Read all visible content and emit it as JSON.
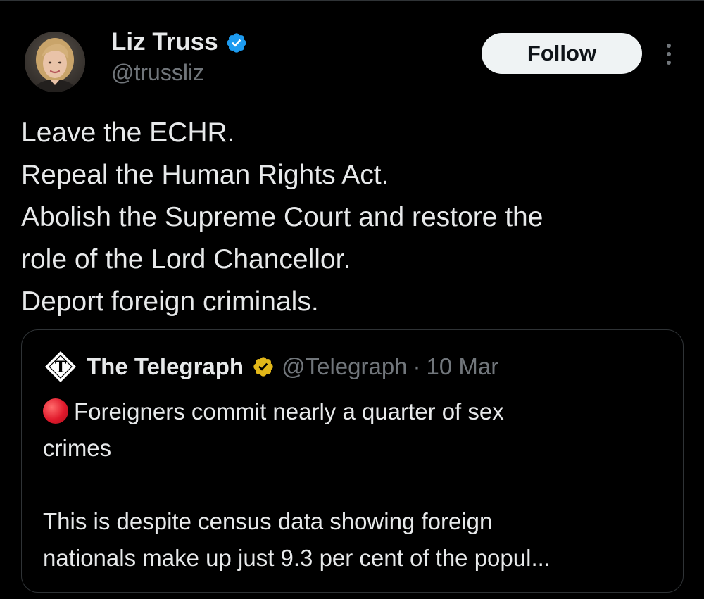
{
  "author": {
    "display_name": "Liz Truss",
    "handle": "@trussliz",
    "verified_badge_icon": "verified-blue-badge-icon",
    "verified_color": "#1d9bf0"
  },
  "actions": {
    "follow_label": "Follow",
    "more_icon": "more-vertical-icon"
  },
  "tweet": {
    "lines": [
      "Leave the ECHR.",
      "Repeal the Human Rights Act.",
      "Abolish the Supreme Court and restore the",
      "role of the Lord Chancellor.",
      "Deport foreign criminals."
    ]
  },
  "quoted": {
    "display_name": "The Telegraph",
    "handle": "@Telegraph",
    "separator": "·",
    "date": "10 Mar",
    "badge_icon": "verified-gold-badge-icon",
    "badge_color": "#e2b719",
    "logo_icon": "telegraph-logo-icon",
    "emoji_icon": "red-circle-icon",
    "paragraph1_lines": [
      "Foreigners commit nearly a quarter of sex",
      "crimes"
    ],
    "paragraph2_lines": [
      "This is despite census data showing foreign",
      "nationals make up just 9.3 per cent of the popul..."
    ]
  },
  "colors": {
    "background": "#000000",
    "text": "#e7e9ea",
    "secondary_text": "#71767b",
    "border": "#2f3336"
  }
}
